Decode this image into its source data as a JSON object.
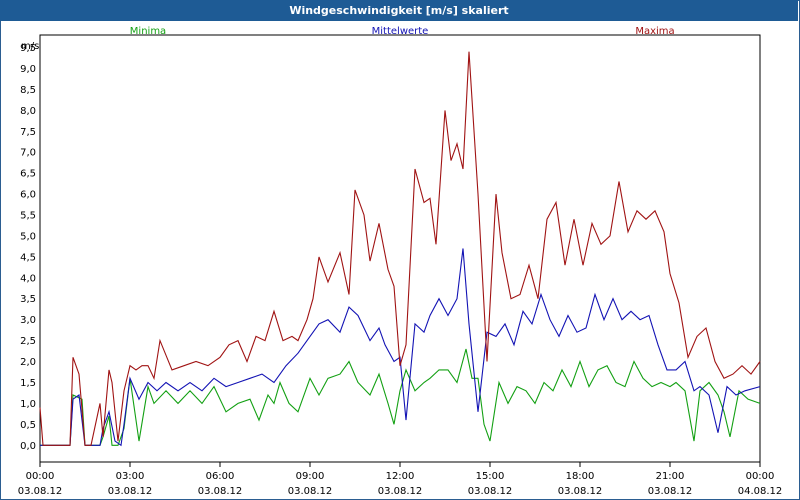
{
  "window": {
    "title": "Windgeschwindigkeit [m/s] skaliert"
  },
  "colors": {
    "minima": "#13a013",
    "mittelwerte": "#1313b4",
    "maxima": "#a01313",
    "title_bg": "#1e5b95"
  },
  "chart_data": {
    "type": "line",
    "title": "Windgeschwindigkeit [m/s] skaliert",
    "ylabel": "m/s",
    "xlabel": "",
    "ylim": [
      -0.4,
      9.8
    ],
    "xlim": [
      0,
      24
    ],
    "grid": true,
    "legend_placement": "top",
    "yticks": [
      "0,0",
      "0,5",
      "1,0",
      "1,5",
      "2,0",
      "2,5",
      "3,0",
      "3,5",
      "4,0",
      "4,5",
      "5,0",
      "5,5",
      "6,0",
      "6,5",
      "7,0",
      "7,5",
      "8,0",
      "8,5",
      "9,0",
      "9,5"
    ],
    "ytick_values": [
      0,
      0.5,
      1,
      1.5,
      2,
      2.5,
      3,
      3.5,
      4,
      4.5,
      5,
      5.5,
      6,
      6.5,
      7,
      7.5,
      8,
      8.5,
      9,
      9.5
    ],
    "xticks": [
      {
        "time": "00:00",
        "date": "03.08.12"
      },
      {
        "time": "03:00",
        "date": "03.08.12"
      },
      {
        "time": "06:00",
        "date": "03.08.12"
      },
      {
        "time": "09:00",
        "date": "03.08.12"
      },
      {
        "time": "12:00",
        "date": "03.08.12"
      },
      {
        "time": "15:00",
        "date": "03.08.12"
      },
      {
        "time": "18:00",
        "date": "03.08.12"
      },
      {
        "time": "21:00",
        "date": "03.08.12"
      },
      {
        "time": "00:00",
        "date": "04.08.12"
      }
    ],
    "series": [
      {
        "name": "Minima",
        "color": "#13a013",
        "x": [
          0,
          0.1,
          1,
          1.1,
          1.4,
          1.5,
          1.7,
          2.0,
          2.1,
          2.3,
          2.4,
          2.6,
          2.8,
          3.0,
          3.3,
          3.6,
          3.8,
          4.2,
          4.6,
          5.0,
          5.4,
          5.8,
          6.2,
          6.6,
          7.0,
          7.3,
          7.6,
          7.8,
          8.0,
          8.3,
          8.6,
          9.0,
          9.3,
          9.6,
          10.0,
          10.3,
          10.6,
          11.0,
          11.3,
          11.6,
          11.8,
          12.0,
          12.2,
          12.5,
          12.8,
          13.0,
          13.3,
          13.6,
          13.9,
          14.2,
          14.4,
          14.6,
          14.8,
          15.0,
          15.3,
          15.6,
          15.9,
          16.2,
          16.5,
          16.8,
          17.1,
          17.4,
          17.7,
          18.0,
          18.3,
          18.6,
          18.9,
          19.2,
          19.5,
          19.8,
          20.1,
          20.4,
          20.7,
          21.0,
          21.2,
          21.5,
          21.8,
          22.0,
          22.3,
          22.6,
          22.8,
          23.0,
          23.3,
          23.6,
          24.0
        ],
        "y": [
          0,
          0,
          0,
          1.2,
          1.1,
          0,
          0,
          0,
          0.2,
          0.7,
          0,
          0,
          0.4,
          1.6,
          0.1,
          1.4,
          1.0,
          1.3,
          1.0,
          1.3,
          1.0,
          1.4,
          0.8,
          1.0,
          1.1,
          0.6,
          1.2,
          1.0,
          1.5,
          1.0,
          0.8,
          1.6,
          1.2,
          1.6,
          1.7,
          2.0,
          1.5,
          1.2,
          1.7,
          1.0,
          0.5,
          1.3,
          1.8,
          1.3,
          1.5,
          1.6,
          1.8,
          1.8,
          1.5,
          2.3,
          1.6,
          1.6,
          0.5,
          0.1,
          1.5,
          1.0,
          1.4,
          1.3,
          1.0,
          1.5,
          1.3,
          1.8,
          1.4,
          2.0,
          1.4,
          1.8,
          1.9,
          1.5,
          1.4,
          2.0,
          1.6,
          1.4,
          1.5,
          1.4,
          1.5,
          1.3,
          0.1,
          1.3,
          1.5,
          1.2,
          0.8,
          0.2,
          1.3,
          1.1,
          1.0
        ]
      },
      {
        "name": "Mittelwerte",
        "color": "#1313b4",
        "x": [
          0,
          0.1,
          1,
          1.1,
          1.3,
          1.5,
          1.7,
          2.0,
          2.1,
          2.3,
          2.5,
          2.7,
          2.8,
          3.0,
          3.3,
          3.6,
          3.9,
          4.2,
          4.6,
          5.0,
          5.4,
          5.8,
          6.2,
          6.6,
          7.0,
          7.4,
          7.8,
          8.2,
          8.6,
          9.0,
          9.3,
          9.6,
          10.0,
          10.3,
          10.6,
          11.0,
          11.3,
          11.5,
          11.8,
          12.0,
          12.2,
          12.5,
          12.8,
          13.0,
          13.3,
          13.6,
          13.9,
          14.1,
          14.3,
          14.6,
          14.9,
          15.2,
          15.5,
          15.8,
          16.1,
          16.4,
          16.7,
          17.0,
          17.3,
          17.6,
          17.9,
          18.2,
          18.5,
          18.8,
          19.1,
          19.4,
          19.7,
          20.0,
          20.3,
          20.6,
          20.9,
          21.2,
          21.5,
          21.8,
          22.0,
          22.3,
          22.6,
          22.9,
          23.2,
          23.5,
          24.0
        ],
        "y": [
          0,
          0,
          0,
          1.1,
          1.2,
          0,
          0,
          0,
          0.4,
          0.8,
          0.1,
          0,
          0.5,
          1.6,
          1.1,
          1.5,
          1.3,
          1.5,
          1.3,
          1.5,
          1.3,
          1.6,
          1.4,
          1.5,
          1.6,
          1.7,
          1.5,
          1.9,
          2.2,
          2.6,
          2.9,
          3.0,
          2.7,
          3.3,
          3.1,
          2.5,
          2.8,
          2.4,
          2.0,
          2.1,
          0.6,
          2.9,
          2.7,
          3.1,
          3.5,
          3.1,
          3.5,
          4.7,
          2.9,
          0.8,
          2.7,
          2.6,
          2.9,
          2.4,
          3.2,
          2.9,
          3.6,
          3.0,
          2.6,
          3.1,
          2.7,
          2.8,
          3.6,
          3.0,
          3.5,
          3.0,
          3.2,
          3.0,
          3.1,
          2.4,
          1.8,
          1.8,
          2.0,
          1.3,
          1.4,
          1.2,
          0.3,
          1.4,
          1.2,
          1.3,
          1.4
        ]
      },
      {
        "name": "Maxima",
        "color": "#a01313",
        "x": [
          0,
          0.1,
          1,
          1.1,
          1.3,
          1.5,
          1.7,
          2.0,
          2.1,
          2.3,
          2.4,
          2.6,
          2.8,
          3.0,
          3.2,
          3.4,
          3.6,
          3.8,
          4.0,
          4.4,
          4.8,
          5.2,
          5.6,
          6.0,
          6.3,
          6.6,
          6.9,
          7.2,
          7.5,
          7.8,
          8.1,
          8.4,
          8.6,
          8.9,
          9.1,
          9.3,
          9.6,
          10.0,
          10.3,
          10.5,
          10.8,
          11.0,
          11.3,
          11.6,
          11.8,
          12.0,
          12.2,
          12.5,
          12.8,
          13.0,
          13.2,
          13.5,
          13.7,
          13.9,
          14.1,
          14.3,
          14.6,
          14.9,
          15.2,
          15.4,
          15.7,
          16.0,
          16.3,
          16.6,
          16.9,
          17.2,
          17.5,
          17.8,
          18.1,
          18.4,
          18.7,
          19.0,
          19.3,
          19.6,
          19.9,
          20.2,
          20.5,
          20.8,
          21.0,
          21.3,
          21.6,
          21.9,
          22.2,
          22.5,
          22.8,
          23.1,
          23.4,
          23.7,
          24.0
        ],
        "y": [
          0.9,
          0,
          0,
          2.1,
          1.7,
          0,
          0,
          1.0,
          0.2,
          1.8,
          1.5,
          0.1,
          1.3,
          1.9,
          1.8,
          1.9,
          1.9,
          1.6,
          2.5,
          1.8,
          1.9,
          2.0,
          1.9,
          2.1,
          2.4,
          2.5,
          2.0,
          2.6,
          2.5,
          3.2,
          2.5,
          2.6,
          2.5,
          3.0,
          3.5,
          4.5,
          3.9,
          4.6,
          3.6,
          6.1,
          5.5,
          4.4,
          5.3,
          4.2,
          3.8,
          1.9,
          2.4,
          6.6,
          5.8,
          5.9,
          4.8,
          8.0,
          6.8,
          7.2,
          6.6,
          9.4,
          6.0,
          2.0,
          6.0,
          4.6,
          3.5,
          3.6,
          4.3,
          3.5,
          5.4,
          5.8,
          4.3,
          5.4,
          4.3,
          5.3,
          4.8,
          5.0,
          6.3,
          5.1,
          5.6,
          5.4,
          5.6,
          5.1,
          4.1,
          3.4,
          2.1,
          2.6,
          2.8,
          2.0,
          1.6,
          1.7,
          1.9,
          1.7,
          2.0
        ]
      }
    ]
  }
}
